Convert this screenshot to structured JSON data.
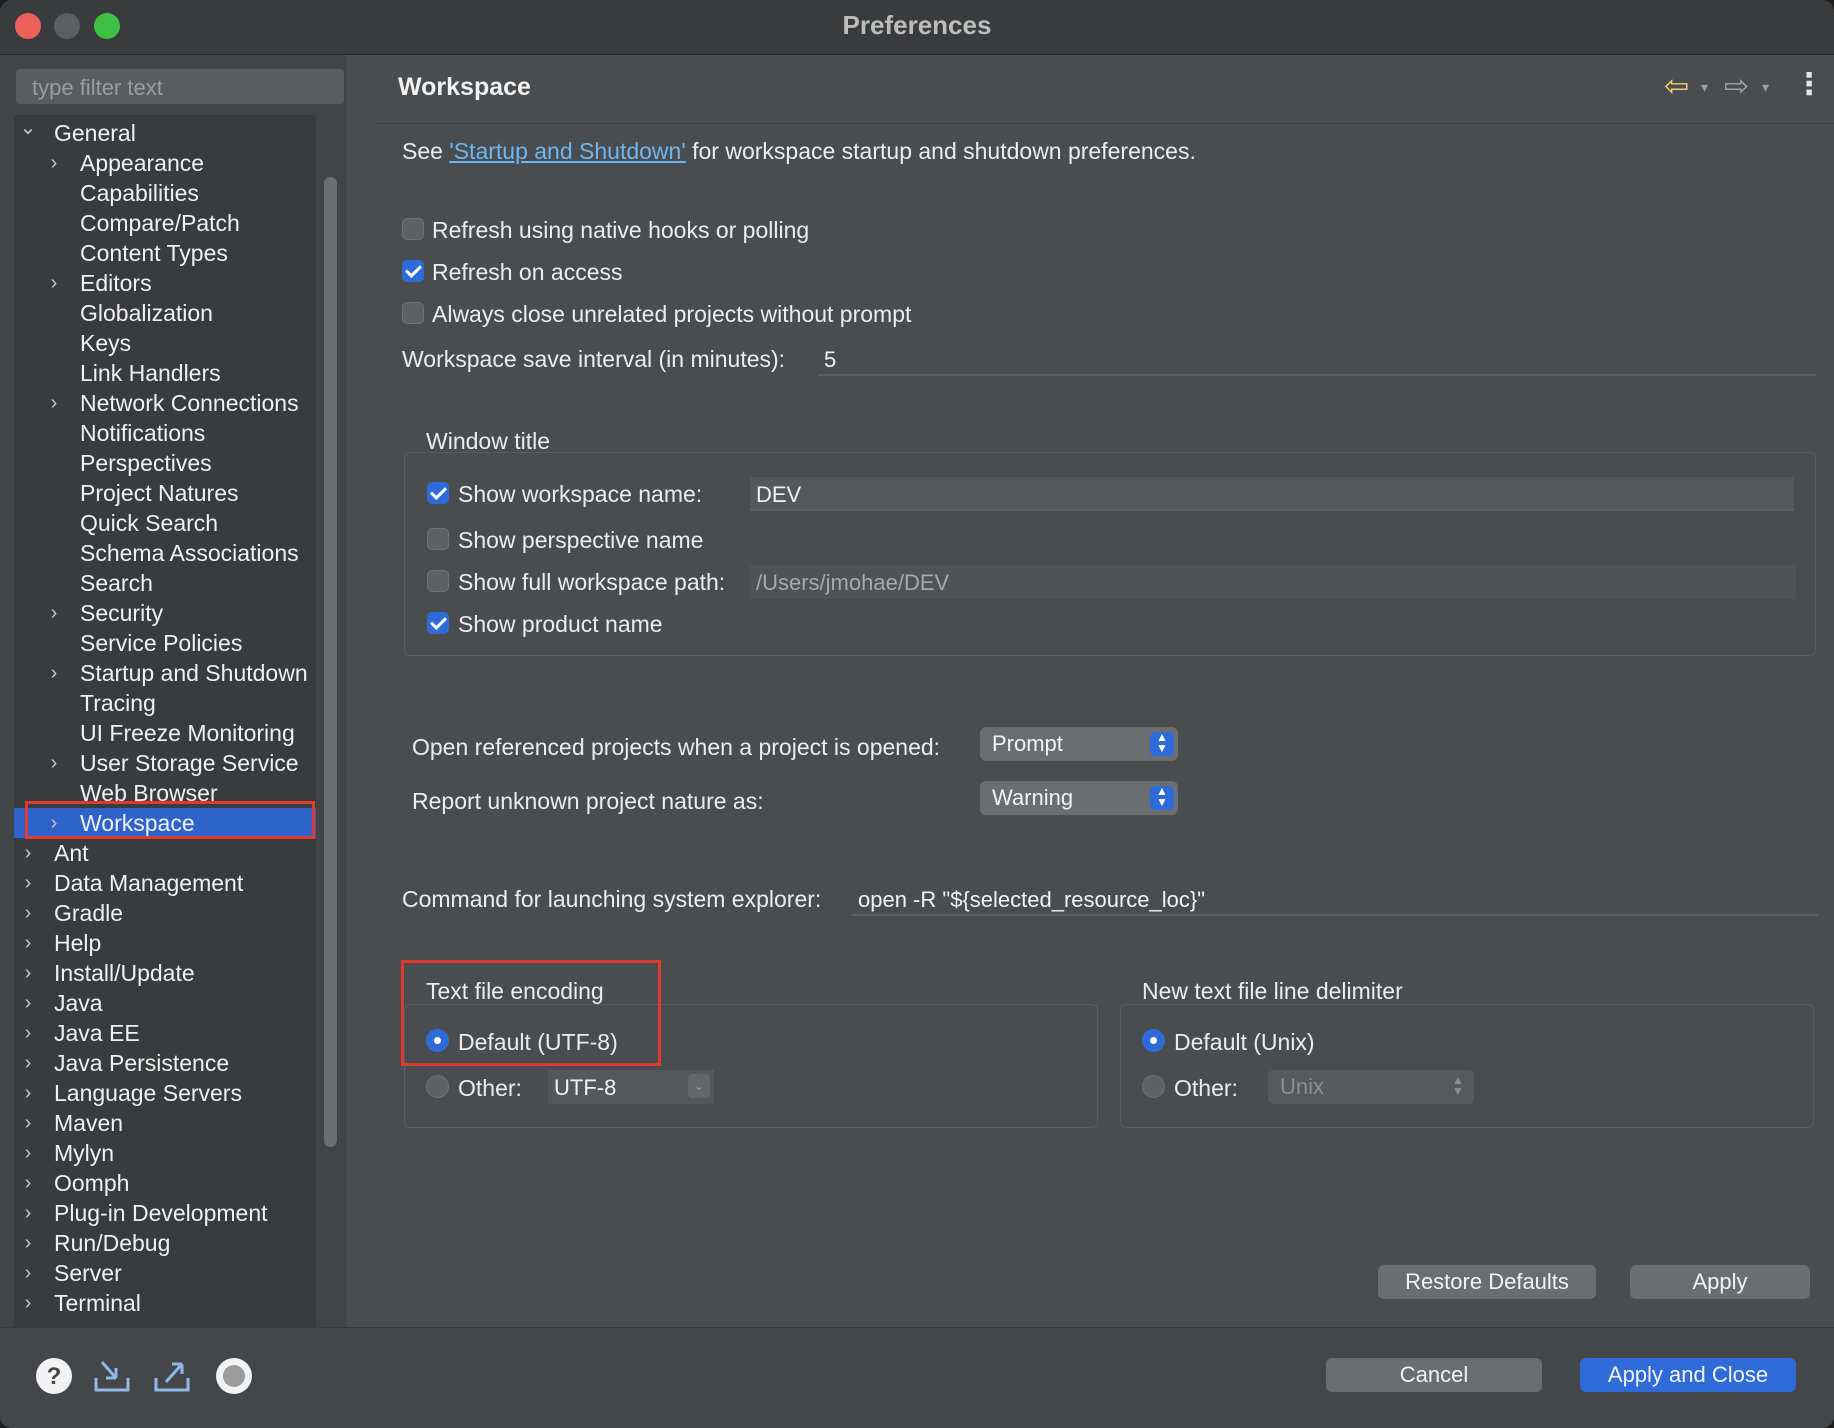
{
  "window": {
    "title": "Preferences"
  },
  "filter": {
    "placeholder": "type filter text"
  },
  "tree": [
    {
      "label": "General",
      "expanded": true,
      "level": 0
    },
    {
      "label": "Appearance",
      "level": 1,
      "chevron": true
    },
    {
      "label": "Capabilities",
      "level": 1
    },
    {
      "label": "Compare/Patch",
      "level": 1
    },
    {
      "label": "Content Types",
      "level": 1
    },
    {
      "label": "Editors",
      "level": 1,
      "chevron": true
    },
    {
      "label": "Globalization",
      "level": 1
    },
    {
      "label": "Keys",
      "level": 1
    },
    {
      "label": "Link Handlers",
      "level": 1
    },
    {
      "label": "Network Connections",
      "level": 1,
      "chevron": true
    },
    {
      "label": "Notifications",
      "level": 1
    },
    {
      "label": "Perspectives",
      "level": 1
    },
    {
      "label": "Project Natures",
      "level": 1
    },
    {
      "label": "Quick Search",
      "level": 1
    },
    {
      "label": "Schema Associations",
      "level": 1
    },
    {
      "label": "Search",
      "level": 1
    },
    {
      "label": "Security",
      "level": 1,
      "chevron": true
    },
    {
      "label": "Service Policies",
      "level": 1
    },
    {
      "label": "Startup and Shutdown",
      "level": 1,
      "chevron": true
    },
    {
      "label": "Tracing",
      "level": 1
    },
    {
      "label": "UI Freeze Monitoring",
      "level": 1
    },
    {
      "label": "User Storage Service",
      "level": 1,
      "chevron": true
    },
    {
      "label": "Web Browser",
      "level": 1
    },
    {
      "label": "Workspace",
      "level": 1,
      "chevron": true,
      "selected": true
    },
    {
      "label": "Ant",
      "level": 0,
      "chevron": true
    },
    {
      "label": "Data Management",
      "level": 0,
      "chevron": true
    },
    {
      "label": "Gradle",
      "level": 0,
      "chevron": true
    },
    {
      "label": "Help",
      "level": 0,
      "chevron": true
    },
    {
      "label": "Install/Update",
      "level": 0,
      "chevron": true
    },
    {
      "label": "Java",
      "level": 0,
      "chevron": true
    },
    {
      "label": "Java EE",
      "level": 0,
      "chevron": true
    },
    {
      "label": "Java Persistence",
      "level": 0,
      "chevron": true
    },
    {
      "label": "Language Servers",
      "level": 0,
      "chevron": true
    },
    {
      "label": "Maven",
      "level": 0,
      "chevron": true
    },
    {
      "label": "Mylyn",
      "level": 0,
      "chevron": true
    },
    {
      "label": "Oomph",
      "level": 0,
      "chevron": true
    },
    {
      "label": "Plug-in Development",
      "level": 0,
      "chevron": true
    },
    {
      "label": "Run/Debug",
      "level": 0,
      "chevron": true
    },
    {
      "label": "Server",
      "level": 0,
      "chevron": true
    },
    {
      "label": "Terminal",
      "level": 0,
      "chevron": true
    }
  ],
  "page": {
    "title": "Workspace",
    "intro_prefix": "See ",
    "intro_link": "'Startup and Shutdown'",
    "intro_suffix": " for workspace startup and shutdown preferences.",
    "refresh_native": {
      "label": "Refresh using native hooks or polling",
      "checked": false
    },
    "refresh_access": {
      "label": "Refresh on access",
      "checked": true
    },
    "close_unrelated": {
      "label": "Always close unrelated projects without prompt",
      "checked": false
    },
    "save_interval": {
      "label": "Workspace save interval (in minutes):",
      "value": "5"
    },
    "window_title": {
      "heading": "Window title",
      "show_workspace_name": {
        "label": "Show workspace name:",
        "checked": true,
        "value": "DEV"
      },
      "show_perspective_name": {
        "label": "Show perspective name",
        "checked": false
      },
      "show_full_path": {
        "label": "Show full workspace path:",
        "checked": false,
        "value": "/Users/jmohae/DEV"
      },
      "show_product_name": {
        "label": "Show product name",
        "checked": true
      }
    },
    "open_referenced": {
      "label": "Open referenced projects when a project is opened:",
      "value": "Prompt"
    },
    "report_unknown": {
      "label": "Report unknown project nature as:",
      "value": "Warning"
    },
    "system_explorer": {
      "label": "Command for launching system explorer:",
      "value": "open -R \"${selected_resource_loc}\""
    },
    "encoding": {
      "heading": "Text file encoding",
      "default_label": "Default (UTF-8)",
      "other_label": "Other:",
      "other_value": "UTF-8"
    },
    "delimiter": {
      "heading": "New text file line delimiter",
      "default_label": "Default (Unix)",
      "other_label": "Other:",
      "other_value": "Unix"
    },
    "restore_defaults": "Restore Defaults",
    "apply": "Apply"
  },
  "footer": {
    "cancel": "Cancel",
    "apply_close": "Apply and Close",
    "icons": [
      "help-icon",
      "import-icon",
      "export-icon",
      "record-icon"
    ]
  },
  "colors": {
    "accent": "#2f6bd8",
    "highlight": "#e03a2e",
    "link": "#6cb6f2"
  }
}
